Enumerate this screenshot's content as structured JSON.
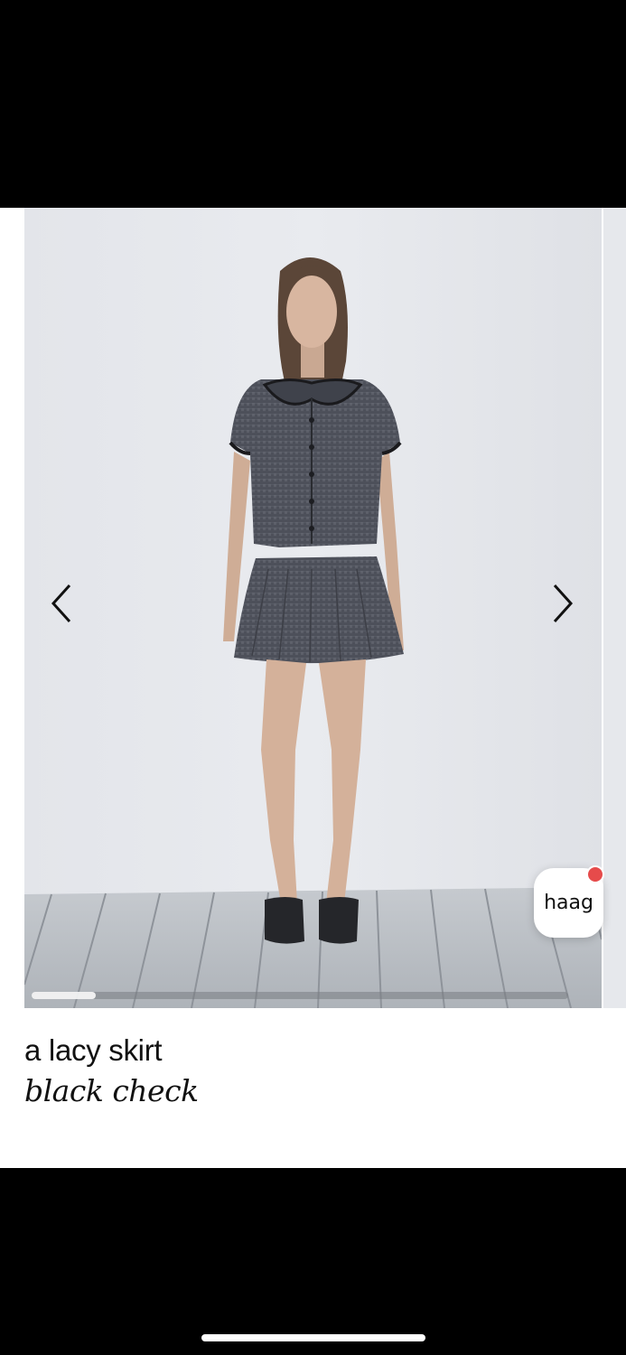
{
  "product": {
    "name": "a lacy skirt",
    "variant": "black check"
  },
  "gallery": {
    "progress": 0.12,
    "prev_icon": "chevron-left-icon",
    "next_icon": "chevron-right-icon"
  },
  "chat": {
    "label": "haag",
    "has_notification": true,
    "notification_color": "#e64b4b"
  },
  "colors": {
    "background": "#000000",
    "sheet": "#ffffff",
    "wall": "#e4e6ea",
    "garment": "#4a4d57"
  }
}
